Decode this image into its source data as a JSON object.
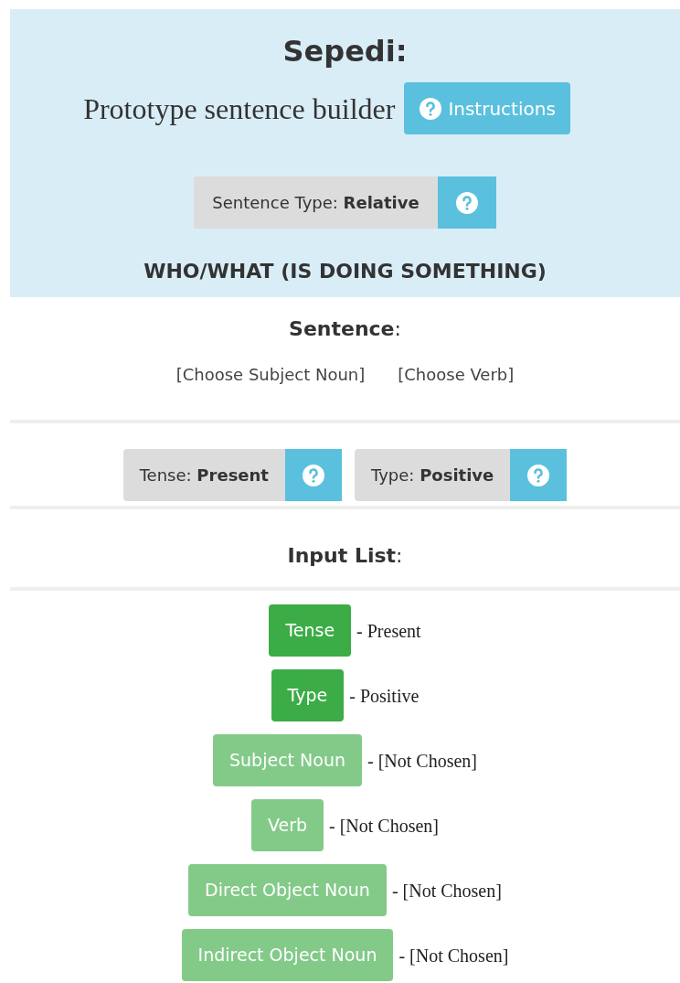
{
  "header": {
    "title": "Sepedi:",
    "subtitle": "Prototype sentence builder",
    "instructions_button": "Instructions",
    "sentence_type": "Sentence Type: **Relative**",
    "section": "WHO/WHAT (IS DOING SOMETHING)"
  },
  "sentence": {
    "heading": "**Sentence**:",
    "slots": [
      "[Choose Subject Noun]",
      "[Choose Verb]"
    ]
  },
  "options": [
    {
      "label": "Tense: **Present**"
    },
    {
      "label": "Type: **Positive**"
    }
  ],
  "input_list": {
    "heading": "**Input List**:",
    "items": [
      {
        "label": "Tense",
        "value": "- Present",
        "chosen": true
      },
      {
        "label": "Type",
        "value": "- Positive",
        "chosen": true
      },
      {
        "label": "Subject Noun",
        "value": "- [Not Chosen]",
        "chosen": false
      },
      {
        "label": "Verb",
        "value": "- [Not Chosen]",
        "chosen": false
      },
      {
        "label": "Direct Object Noun",
        "value": "- [Not Chosen]",
        "chosen": false
      },
      {
        "label": "Indirect Object Noun",
        "value": "- [Not Chosen]",
        "chosen": false
      }
    ]
  }
}
